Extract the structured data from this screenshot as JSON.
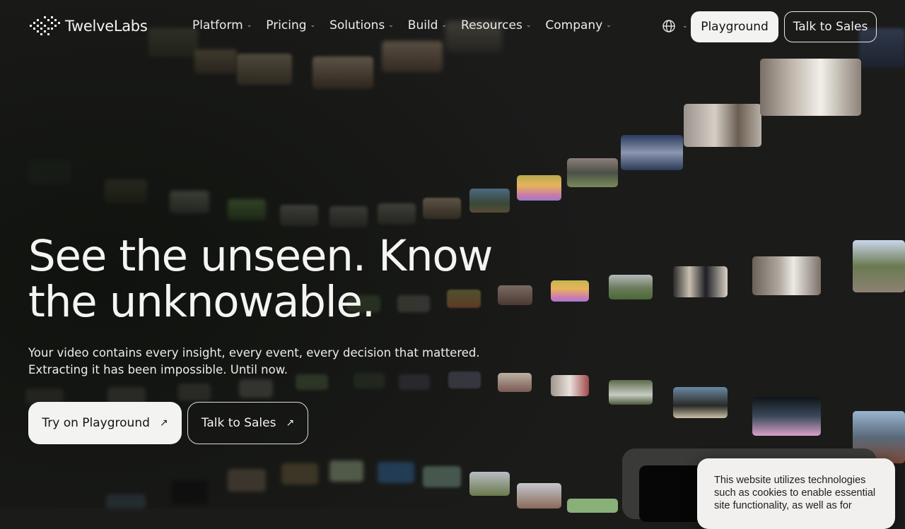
{
  "brand": {
    "name": "TwelveLabs"
  },
  "nav": {
    "items": [
      {
        "label": "Platform"
      },
      {
        "label": "Pricing"
      },
      {
        "label": "Solutions"
      },
      {
        "label": "Build"
      },
      {
        "label": "Resources"
      },
      {
        "label": "Company"
      }
    ],
    "playground_label": "Playground",
    "talk_label": "Talk to Sales"
  },
  "hero": {
    "title_line1": "See the unseen. Know",
    "title_line2": "the unknowable.",
    "subtitle_line1": "Your video contains every insight, every event, every decision that mattered.",
    "subtitle_line2": "Extracting it has been impossible. Until now.",
    "cta_primary": "Try on Playground",
    "cta_secondary": "Talk to Sales"
  },
  "cookie": {
    "text": "This website utilizes technologies such as cookies to enable essential site functionality, as well as for"
  },
  "icons": {
    "globe": "globe-icon",
    "chevron": "chevron-down-icon",
    "arrow": "arrow-up-right-icon",
    "logo": "logo-mark-icon"
  },
  "colors": {
    "background": "#1b1b1a",
    "button_light": "#f3f3f1",
    "cookie_bg": "#f1f0ee"
  }
}
